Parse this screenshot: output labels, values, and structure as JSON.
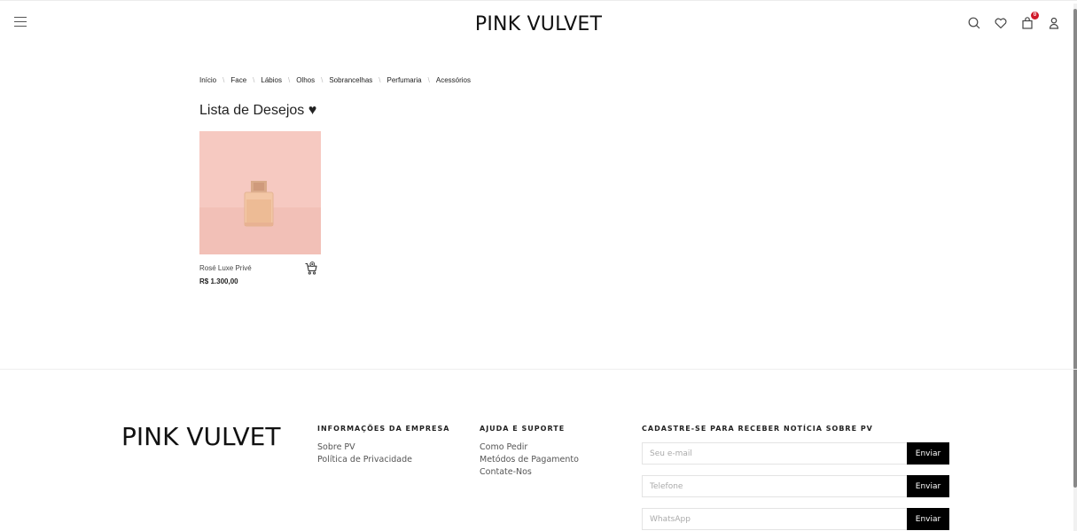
{
  "header": {
    "brand": "PINK VULVET",
    "cart_count": "0",
    "icons": [
      "menu-icon",
      "search-icon",
      "heart-icon",
      "shopping-bag-icon",
      "user-icon"
    ]
  },
  "breadcrumb": [
    "Início",
    "Face",
    "Lábios",
    "Olhos",
    "Sobrancelhas",
    "Perfumaria",
    "Acessórios"
  ],
  "page_title": "Lista de Desejos ♥",
  "product": {
    "name": "Rosé Luxe Privé",
    "price": "R$ 1.300,00",
    "image_bg": "#f6c9c1"
  },
  "footer": {
    "brand": "PINK VULVET",
    "company": {
      "heading": "INFORMAÇÕES DA EMPRESA",
      "links": [
        "Sobre PV",
        "Política de Privacidade"
      ]
    },
    "help": {
      "heading": "AJUDA E SUPORTE",
      "links": [
        "Como Pedir",
        "Metódos de Pagamento",
        "Contate-Nos"
      ]
    },
    "newsletter": {
      "heading": "CADASTRE-SE PARA RECEBER NOTÍCIA SOBRE PV",
      "email_placeholder": "Seu e-mail",
      "phone_placeholder": "Telefone",
      "whatsapp_placeholder": "WhatsApp",
      "button_label": "Enviar"
    }
  },
  "colors": {
    "accent": "#000000",
    "badge": "#d01a2a"
  }
}
